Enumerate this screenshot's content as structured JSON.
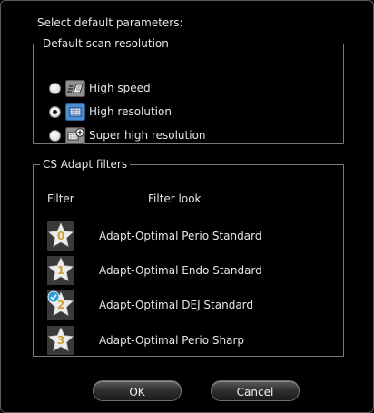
{
  "dialog": {
    "prompt": "Select default parameters:"
  },
  "resolution": {
    "legend": "Default scan resolution",
    "options": [
      {
        "label": "High speed",
        "icon": "high-speed-icon",
        "checked": false
      },
      {
        "label": "High resolution",
        "icon": "high-resolution-icon",
        "checked": true
      },
      {
        "label": "Super high resolution",
        "icon": "super-high-resolution-icon",
        "checked": false
      }
    ]
  },
  "filters": {
    "legend": "CS Adapt filters",
    "col_filter": "Filter",
    "col_look": "Filter look",
    "items": [
      {
        "number": "0",
        "label": "Adapt-Optimal Perio Standard",
        "selected": false
      },
      {
        "number": "1",
        "label": "Adapt-Optimal Endo Standard",
        "selected": false
      },
      {
        "number": "2",
        "label": "Adapt-Optimal DEJ Standard",
        "selected": true
      },
      {
        "number": "3",
        "label": "Adapt-Optimal Perio Sharp",
        "selected": false
      }
    ]
  },
  "buttons": {
    "ok": "OK",
    "cancel": "Cancel"
  },
  "colors": {
    "star": "#ececec",
    "tile": "#3a3a3a",
    "number": "#c9a23a",
    "check": "#2a9fe0",
    "selected_icon_bg": "#4a8fd4"
  }
}
